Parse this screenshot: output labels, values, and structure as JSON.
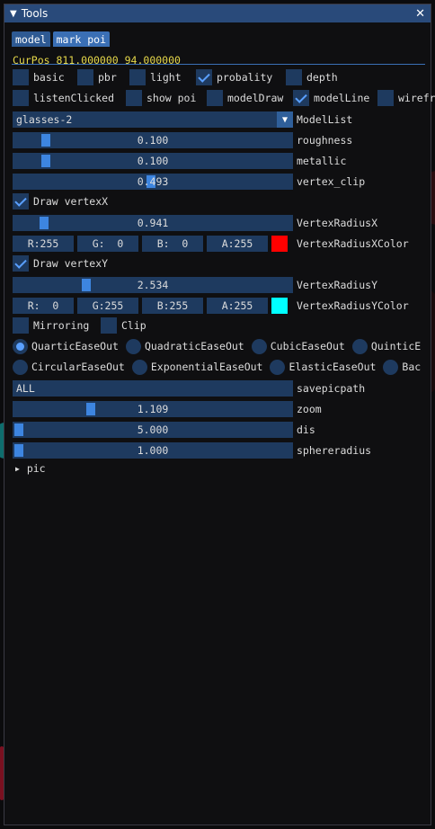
{
  "window": {
    "title": "Tools",
    "collapse_icon": "triangle-down",
    "close_icon": "close-x"
  },
  "tabs": [
    {
      "label": "model"
    },
    {
      "label": "mark poi"
    }
  ],
  "cur_pos": "CurPos 811.000000 94.000000",
  "checkbox_row1": [
    {
      "label": "basic",
      "checked": false
    },
    {
      "label": "pbr",
      "checked": false
    },
    {
      "label": "light",
      "checked": false
    },
    {
      "label": "probality",
      "checked": true
    },
    {
      "label": "depth",
      "checked": false
    }
  ],
  "checkbox_row2": [
    {
      "label": "listenClicked",
      "checked": false
    },
    {
      "label": "show poi",
      "checked": false
    },
    {
      "label": "modelDraw",
      "checked": false
    },
    {
      "label": "modelLine",
      "checked": true
    },
    {
      "label": "wirefra",
      "checked": false
    }
  ],
  "model_list": {
    "value": "glasses-2",
    "label": "ModelList"
  },
  "sliders_top": [
    {
      "value": "0.100",
      "label": "roughness",
      "level": 0.1
    },
    {
      "value": "0.100",
      "label": "metallic",
      "level": 0.1
    },
    {
      "value": "0.493",
      "label": "vertex_clip",
      "level": 0.493
    }
  ],
  "vertex_x": {
    "toggle_label": "Draw vertexX",
    "checked": true,
    "radius_value": "0.941",
    "radius_label": "VertexRadiusX",
    "radius_level": 0.094,
    "channels": [
      "R:255",
      "G:  0",
      "B:  0",
      "A:255"
    ],
    "color_label": "VertexRadiusXColor",
    "color": "#ff0000"
  },
  "vertex_y": {
    "toggle_label": "Draw vertexY",
    "checked": true,
    "radius_value": "2.534",
    "radius_label": "VertexRadiusY",
    "radius_level": 0.253,
    "channels": [
      "R:  0",
      "G:255",
      "B:255",
      "A:255"
    ],
    "color_label": "VertexRadiusYColor",
    "color": "#00ffff"
  },
  "mirroring": {
    "label": "Mirroring",
    "checked": false
  },
  "clip": {
    "label": "Clip",
    "checked": false
  },
  "easing_row1": [
    {
      "label": "QuarticEaseOut",
      "selected": true
    },
    {
      "label": "QuadraticEaseOut",
      "selected": false
    },
    {
      "label": "CubicEaseOut",
      "selected": false
    },
    {
      "label": "QuinticE",
      "selected": false
    }
  ],
  "easing_row2": [
    {
      "label": "CircularEaseOut",
      "selected": false
    },
    {
      "label": "ExponentialEaseOut",
      "selected": false
    },
    {
      "label": "ElasticEaseOut",
      "selected": false
    },
    {
      "label": "Bac",
      "selected": false
    }
  ],
  "savepic": {
    "value": "ALL",
    "label": "savepicpath"
  },
  "sliders_bottom": [
    {
      "value": "1.109",
      "label": "zoom",
      "level": 0.27
    },
    {
      "value": "5.000",
      "label": "dis",
      "level": 0.0
    },
    {
      "value": "1.000",
      "label": "sphereradius",
      "level": 0.0
    }
  ],
  "tree_node": {
    "label": "pic",
    "icon": "triangle-right"
  },
  "colors": {
    "accent": "#3d85e0",
    "frame": "#1e3a5f",
    "title_bar": "#294a7a",
    "curpos_text": "#e6d84a"
  }
}
